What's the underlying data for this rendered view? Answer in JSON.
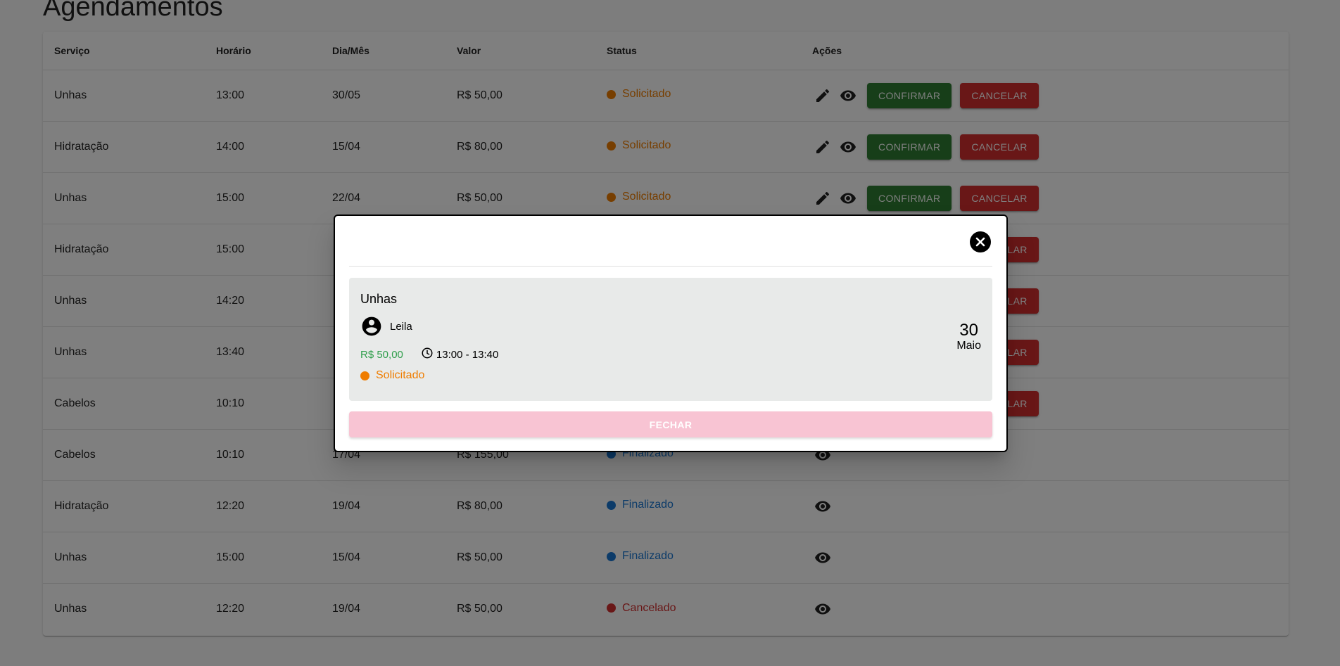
{
  "page": {
    "title": "Agendamentos"
  },
  "table": {
    "headers": [
      "Serviço",
      "Horário",
      "Dia/Mês",
      "Valor",
      "Status",
      "Ações"
    ],
    "rows": [
      {
        "service": "Unhas",
        "time": "13:00",
        "date": "30/05",
        "value": "R$ 50,00",
        "status": "Solicitado",
        "color": "#ef7d00"
      },
      {
        "service": "Hidratação",
        "time": "14:00",
        "date": "15/04",
        "value": "R$ 80,00",
        "status": "Solicitado",
        "color": "#ef7d00"
      },
      {
        "service": "Unhas",
        "time": "15:00",
        "date": "22/04",
        "value": "R$ 50,00",
        "status": "Solicitado",
        "color": "#ef7d00"
      },
      {
        "service": "Hidratação",
        "time": "15:00",
        "date": "",
        "value": "",
        "status": "",
        "color": ""
      },
      {
        "service": "Unhas",
        "time": "14:20",
        "date": "",
        "value": "",
        "status": "",
        "color": ""
      },
      {
        "service": "Unhas",
        "time": "13:40",
        "date": "",
        "value": "",
        "status": "",
        "color": ""
      },
      {
        "service": "Cabelos",
        "time": "10:10",
        "date": "",
        "value": "",
        "status": "",
        "color": ""
      },
      {
        "service": "Cabelos",
        "time": "10:10",
        "date": "17/04",
        "value": "R$ 155,00",
        "status": "Finalizado",
        "color": "#1976d2"
      },
      {
        "service": "Hidratação",
        "time": "12:20",
        "date": "19/04",
        "value": "R$ 80,00",
        "status": "Finalizado",
        "color": "#1976d2"
      },
      {
        "service": "Unhas",
        "time": "15:00",
        "date": "15/04",
        "value": "R$ 50,00",
        "status": "Finalizado",
        "color": "#1976d2"
      },
      {
        "service": "Unhas",
        "time": "12:20",
        "date": "19/04",
        "value": "R$ 50,00",
        "status": "Cancelado",
        "color": "#d32f2f"
      }
    ],
    "actions": {
      "confirm_label": "CONFIRMAR",
      "cancel_label": "CANCELAR"
    }
  },
  "modal": {
    "service": "Unhas",
    "client": "Leila",
    "price": "R$ 50,00",
    "time_range": "13:00 - 13:40",
    "status": "Solicitado",
    "status_color": "#ef7d00",
    "day": "30",
    "month": "Maio",
    "close_label": "FECHAR"
  },
  "colors": {
    "confirm": "#2e7d32",
    "cancel": "#d32f2f",
    "requested": "#ef7d00",
    "finished": "#1976d2",
    "close_button": "#f8c4d3"
  },
  "icons": {
    "edit": "pencil-icon",
    "view": "eye-icon",
    "close": "close-circle-icon",
    "client": "account-circle-icon",
    "time": "clock-icon"
  }
}
